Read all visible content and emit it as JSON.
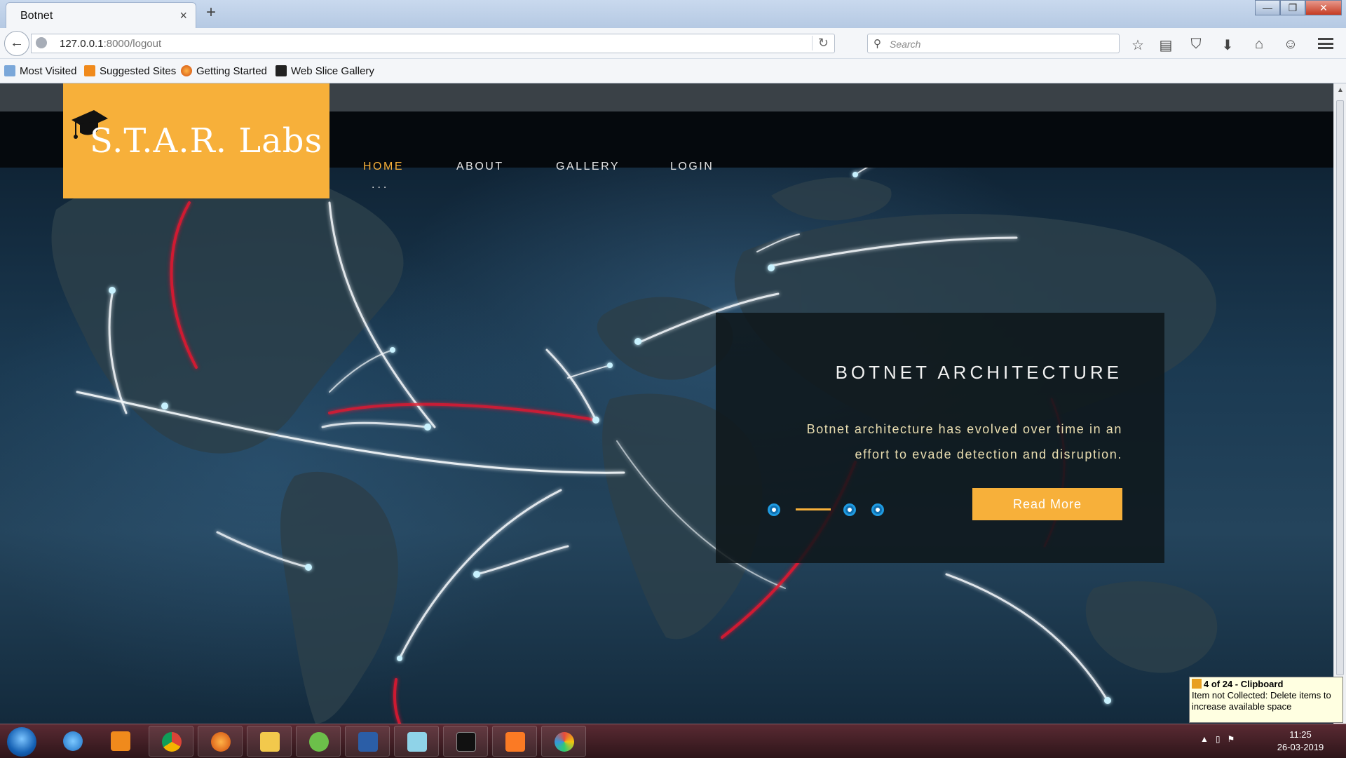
{
  "browser": {
    "tab_title": "Botnet",
    "tab_close": "×",
    "new_tab": "+",
    "url_host": "127.0.0.1",
    "url_path": ":8000/logout",
    "search_placeholder": "Search",
    "bookmarks": [
      {
        "label": "Most Visited",
        "icon": "most-visited-icon"
      },
      {
        "label": "Suggested Sites",
        "icon": "suggested-sites-icon"
      },
      {
        "label": "Getting Started",
        "icon": "firefox-icon"
      },
      {
        "label": "Web Slice Gallery",
        "icon": "web-slice-icon"
      }
    ]
  },
  "site": {
    "logo": "S.T.A.R. Labs",
    "nav": [
      {
        "label": "HOME",
        "active": true
      },
      {
        "label": "ABOUT",
        "active": false
      },
      {
        "label": "GALLERY",
        "active": false
      },
      {
        "label": "LOGIN",
        "active": false
      }
    ],
    "nav_dots": "...",
    "slide": {
      "title": "BOTNET ARCHITECTURE",
      "text": "Botnet architecture has evolved over time in an effort to evade detection and disruption.",
      "button": "Read More"
    },
    "colors": {
      "accent": "#f7b03a",
      "header_bg": "#05090d",
      "panel_bg": "#0e161a"
    }
  },
  "taskbar": {
    "apps": [
      "internet-explorer-icon",
      "media-player-icon",
      "chrome-icon",
      "firefox-icon",
      "file-explorer-icon",
      "utorrent-icon",
      "word-icon",
      "notepad-icon",
      "terminal-icon",
      "xampp-icon",
      "paint-icon"
    ],
    "time": "11:25",
    "date": "26-03-2019"
  },
  "notification": {
    "title": "4 of 24 - Clipboard",
    "text": "Item not Collected: Delete items to increase available space"
  }
}
